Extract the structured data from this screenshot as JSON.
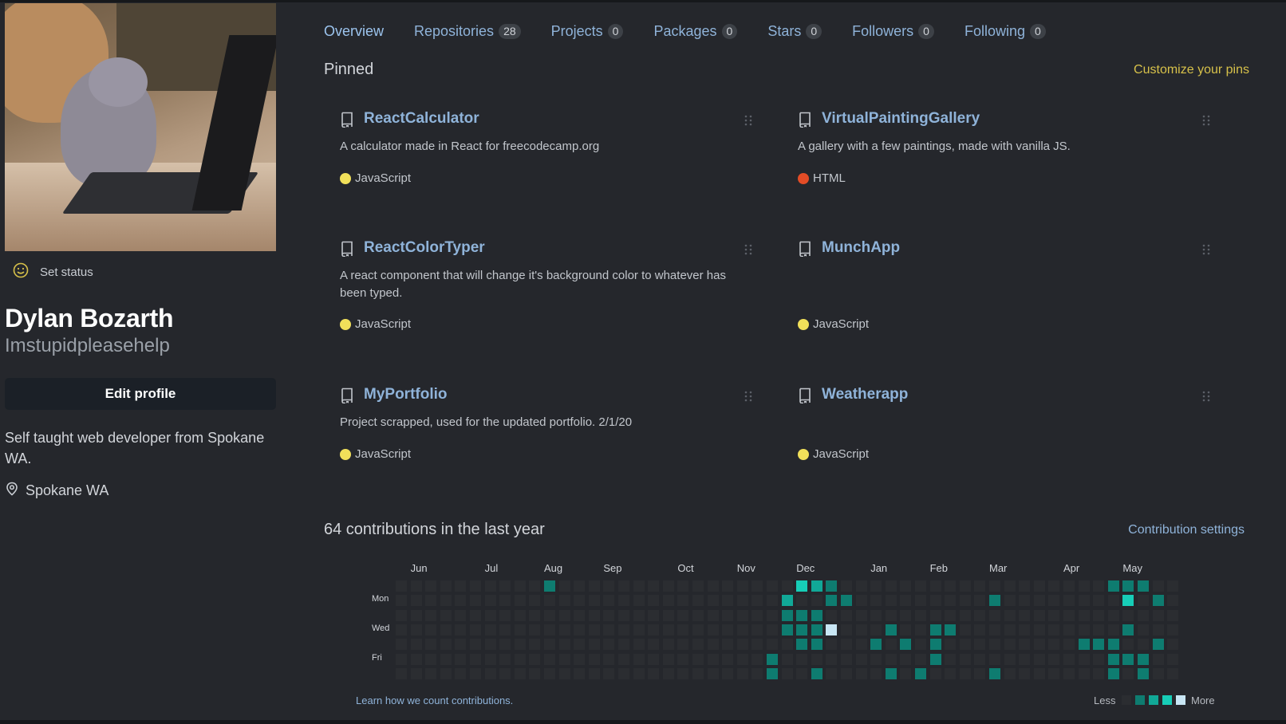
{
  "profile": {
    "status_label": "Set status",
    "full_name": "Dylan Bozarth",
    "username": "Imstupidpleasehelp",
    "edit_label": "Edit profile",
    "bio": "Self taught web developer from Spokane WA.",
    "location": "Spokane WA"
  },
  "tabs": [
    {
      "label": "Overview",
      "count": null
    },
    {
      "label": "Repositories",
      "count": "28"
    },
    {
      "label": "Projects",
      "count": "0"
    },
    {
      "label": "Packages",
      "count": "0"
    },
    {
      "label": "Stars",
      "count": "0"
    },
    {
      "label": "Followers",
      "count": "0"
    },
    {
      "label": "Following",
      "count": "0"
    }
  ],
  "pinned": {
    "title": "Pinned",
    "customize_label": "Customize your pins",
    "repos": [
      {
        "name": "ReactCalculator",
        "description": "A calculator made in React for freecodecamp.org",
        "language": "JavaScript",
        "language_color": "#f1e05a"
      },
      {
        "name": "VirtualPaintingGallery",
        "description": "A gallery with a few paintings, made with vanilla JS.",
        "language": "HTML",
        "language_color": "#e34c26"
      },
      {
        "name": "ReactColorTyper",
        "description": "A react component that will change it's background color to whatever has been typed.",
        "language": "JavaScript",
        "language_color": "#f1e05a"
      },
      {
        "name": "MunchApp",
        "description": "",
        "language": "JavaScript",
        "language_color": "#f1e05a"
      },
      {
        "name": "MyPortfolio",
        "description": "Project scrapped, used for the updated portfolio. 2/1/20",
        "language": "JavaScript",
        "language_color": "#f1e05a"
      },
      {
        "name": "Weatherapp",
        "description": "",
        "language": "JavaScript",
        "language_color": "#f1e05a"
      }
    ]
  },
  "contributions": {
    "title": "64 contributions in the last year",
    "settings_label": "Contribution settings",
    "learn_label": "Learn how we count contributions.",
    "legend_less": "Less",
    "legend_more": "More",
    "months": [
      "Jun",
      "Jul",
      "Aug",
      "Sep",
      "Oct",
      "Nov",
      "Dec",
      "Jan",
      "Feb",
      "Mar",
      "Apr",
      "May"
    ],
    "days": [
      "Mon",
      "Wed",
      "Fri"
    ],
    "level_colors": [
      "#2b2d31",
      "#0e7c70",
      "#11a897",
      "#17cdb7",
      "#c8e6f4"
    ],
    "active_cells": [
      [
        10,
        0,
        1
      ],
      [
        26,
        1,
        2
      ],
      [
        27,
        0,
        3
      ],
      [
        28,
        0,
        2
      ],
      [
        28,
        2,
        1
      ],
      [
        28,
        4,
        1
      ],
      [
        29,
        1,
        1
      ],
      [
        29,
        0,
        1
      ],
      [
        26,
        2,
        1
      ],
      [
        26,
        3,
        1
      ],
      [
        27,
        3,
        1
      ],
      [
        27,
        2,
        1
      ],
      [
        27,
        4,
        1
      ],
      [
        28,
        3,
        1
      ],
      [
        29,
        3,
        4
      ],
      [
        30,
        1,
        1
      ],
      [
        25,
        5,
        1
      ],
      [
        25,
        6,
        1
      ],
      [
        28,
        6,
        1
      ],
      [
        32,
        4,
        1
      ],
      [
        33,
        3,
        1
      ],
      [
        33,
        6,
        1
      ],
      [
        34,
        4,
        1
      ],
      [
        35,
        6,
        1
      ],
      [
        36,
        3,
        1
      ],
      [
        36,
        4,
        1
      ],
      [
        36,
        5,
        1
      ],
      [
        37,
        3,
        1
      ],
      [
        40,
        1,
        1
      ],
      [
        40,
        6,
        1
      ],
      [
        46,
        4,
        1
      ],
      [
        47,
        4,
        1
      ],
      [
        48,
        0,
        1
      ],
      [
        48,
        4,
        1
      ],
      [
        48,
        5,
        1
      ],
      [
        48,
        6,
        1
      ],
      [
        49,
        0,
        1
      ],
      [
        49,
        1,
        3
      ],
      [
        49,
        3,
        1
      ],
      [
        49,
        5,
        1
      ],
      [
        50,
        0,
        1
      ],
      [
        50,
        5,
        1
      ],
      [
        50,
        6,
        1
      ],
      [
        51,
        1,
        1
      ],
      [
        51,
        4,
        1
      ]
    ]
  }
}
